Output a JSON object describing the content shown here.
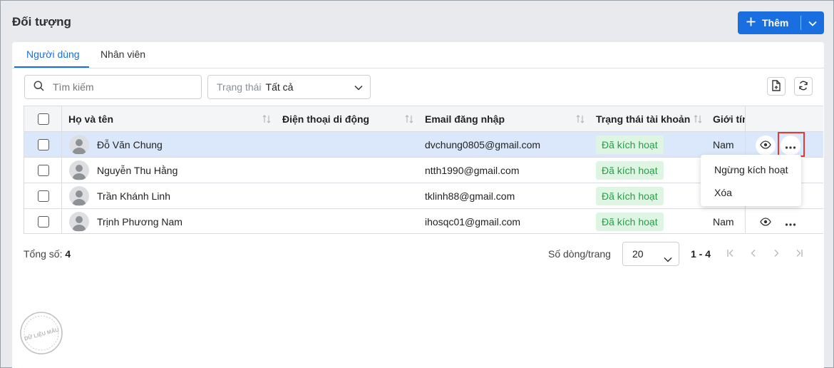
{
  "page": {
    "title": "Đối tượng"
  },
  "add_button": {
    "label": "Thêm"
  },
  "tabs": [
    {
      "label": "Người dùng",
      "active": true
    },
    {
      "label": "Nhân viên",
      "active": false
    }
  ],
  "filters": {
    "search_placeholder": "Tìm kiếm",
    "status_label": "Trạng thái",
    "status_value": "Tất cả"
  },
  "table": {
    "columns": [
      "Họ và tên",
      "Điện thoại di động",
      "Email đăng nhập",
      "Trạng thái tài khoản",
      "Giới tính"
    ],
    "rows": [
      {
        "name": "Đỗ Văn Chung",
        "phone": "",
        "email": "dvchung0805@gmail.com",
        "status": "Đã kích hoạt",
        "gender": "Nam",
        "selected": true
      },
      {
        "name": "Nguyễn Thu Hằng",
        "phone": "",
        "email": "ntth1990@gmail.com",
        "status": "Đã kích hoạt",
        "gender": "",
        "selected": false
      },
      {
        "name": "Trần Khánh Linh",
        "phone": "",
        "email": "tklinh88@gmail.com",
        "status": "Đã kích hoạt",
        "gender": "",
        "selected": false
      },
      {
        "name": "Trịnh Phương Nam",
        "phone": "",
        "email": "ihosqc01@gmail.com",
        "status": "Đã kích hoạt",
        "gender": "Nam",
        "selected": false
      }
    ]
  },
  "context_menu": {
    "items": [
      "Ngừng kích hoạt",
      "Xóa"
    ]
  },
  "footer": {
    "total_label": "Tổng số:",
    "total_value": "4",
    "rows_per_page_label": "Số dòng/trang",
    "page_size": "20",
    "range": "1 - 4"
  },
  "watermark": {
    "text": "DỮ LIỆU MẪU"
  },
  "colors": {
    "accent": "#1a6fe0",
    "badge_bg": "#dff5e4",
    "badge_text": "#22a045",
    "selected_row": "#dbe8fb",
    "highlight": "#e53935"
  }
}
